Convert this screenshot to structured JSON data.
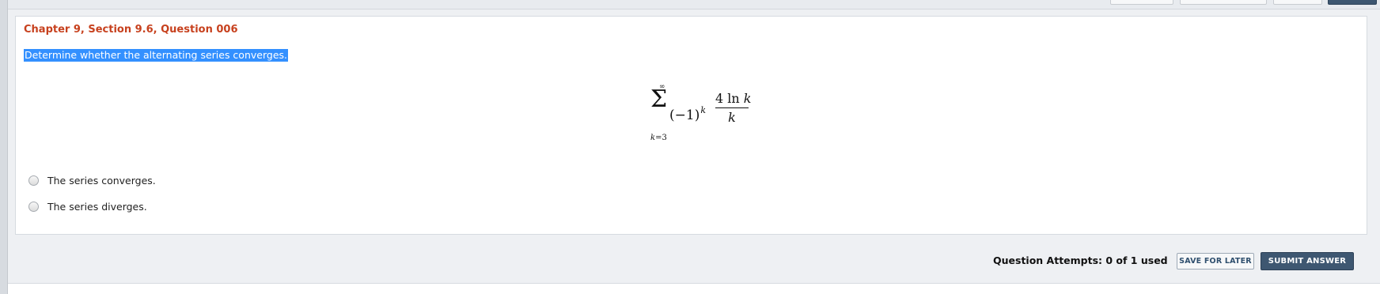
{
  "question": {
    "heading": "Chapter 9, Section 9.6, Question 006",
    "prompt": "Determine whether the alternating series converges."
  },
  "formula": {
    "upper_limit": "∞",
    "sum_symbol": "Σ",
    "lower_index": "k",
    "lower_eq": "=3",
    "base": "(−1)",
    "exponent": "k",
    "numerator_coef": "4 ln ",
    "numerator_var": "k",
    "denominator": "k"
  },
  "options": [
    {
      "label": "The series converges.",
      "selected": false
    },
    {
      "label": "The series diverges.",
      "selected": false
    }
  ],
  "footer": {
    "attempts_label": "Question Attempts: 0 of 1 used",
    "save_label": "SAVE FOR LATER",
    "submit_label": "SUBMIT ANSWER"
  },
  "colors": {
    "heading": "#c7411e",
    "selection_highlight": "#3390ff",
    "submit_button": "#3e5771",
    "save_button_text": "#2f4f6e"
  }
}
